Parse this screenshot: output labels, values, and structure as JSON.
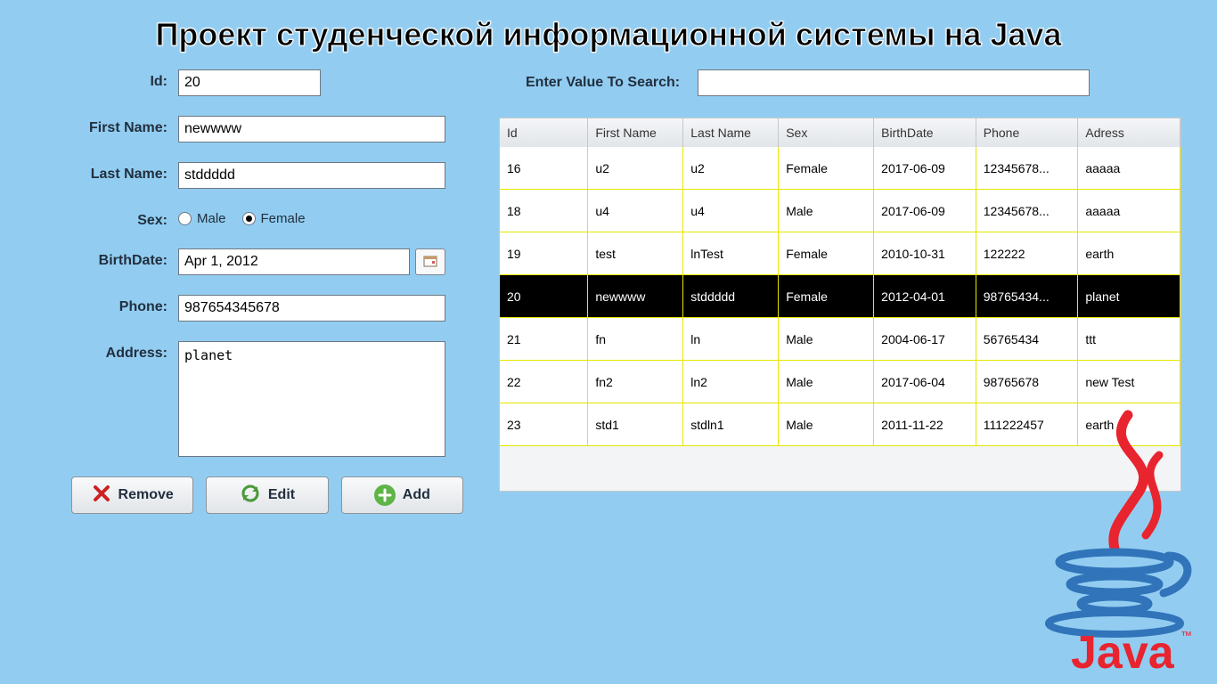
{
  "title": "Проект студенческой информационной системы на Java",
  "form": {
    "labels": {
      "id": "Id:",
      "first_name": "First Name:",
      "last_name": "Last Name:",
      "sex": "Sex:",
      "birthdate": "BirthDate:",
      "phone": "Phone:",
      "address": "Address:"
    },
    "values": {
      "id": "20",
      "first_name": "newwww",
      "last_name": "stddddd",
      "birthdate": "Apr 1, 2012",
      "phone": "987654345678",
      "address": "planet"
    },
    "sex_options": {
      "male": "Male",
      "female": "Female",
      "selected": "female"
    }
  },
  "buttons": {
    "remove": "Remove",
    "edit": "Edit",
    "add": "Add"
  },
  "search": {
    "label": "Enter Value To Search:",
    "value": ""
  },
  "table": {
    "columns": [
      "Id",
      "First Name",
      "Last Name",
      "Sex",
      "BirthDate",
      "Phone",
      "Adress"
    ],
    "rows": [
      {
        "cells": [
          "16",
          "u2",
          "u2",
          "Female",
          "2017-06-09",
          "12345678...",
          "aaaaa"
        ],
        "selected": false
      },
      {
        "cells": [
          "18",
          "u4",
          "u4",
          "Male",
          "2017-06-09",
          "12345678...",
          "aaaaa"
        ],
        "selected": false
      },
      {
        "cells": [
          "19",
          "test",
          "lnTest",
          "Female",
          "2010-10-31",
          "122222",
          "earth"
        ],
        "selected": false
      },
      {
        "cells": [
          "20",
          "newwww",
          "stddddd",
          "Female",
          "2012-04-01",
          "98765434...",
          "planet"
        ],
        "selected": true
      },
      {
        "cells": [
          "21",
          "fn",
          "ln",
          "Male",
          "2004-06-17",
          "56765434",
          "ttt"
        ],
        "selected": false
      },
      {
        "cells": [
          "22",
          "fn2",
          "ln2",
          "Male",
          "2017-06-04",
          "98765678",
          "new Test"
        ],
        "selected": false
      },
      {
        "cells": [
          "23",
          "std1",
          "stdln1",
          "Male",
          "2011-11-22",
          "111222457",
          "earth"
        ],
        "selected": false
      }
    ]
  },
  "logo": {
    "text": "Java"
  }
}
